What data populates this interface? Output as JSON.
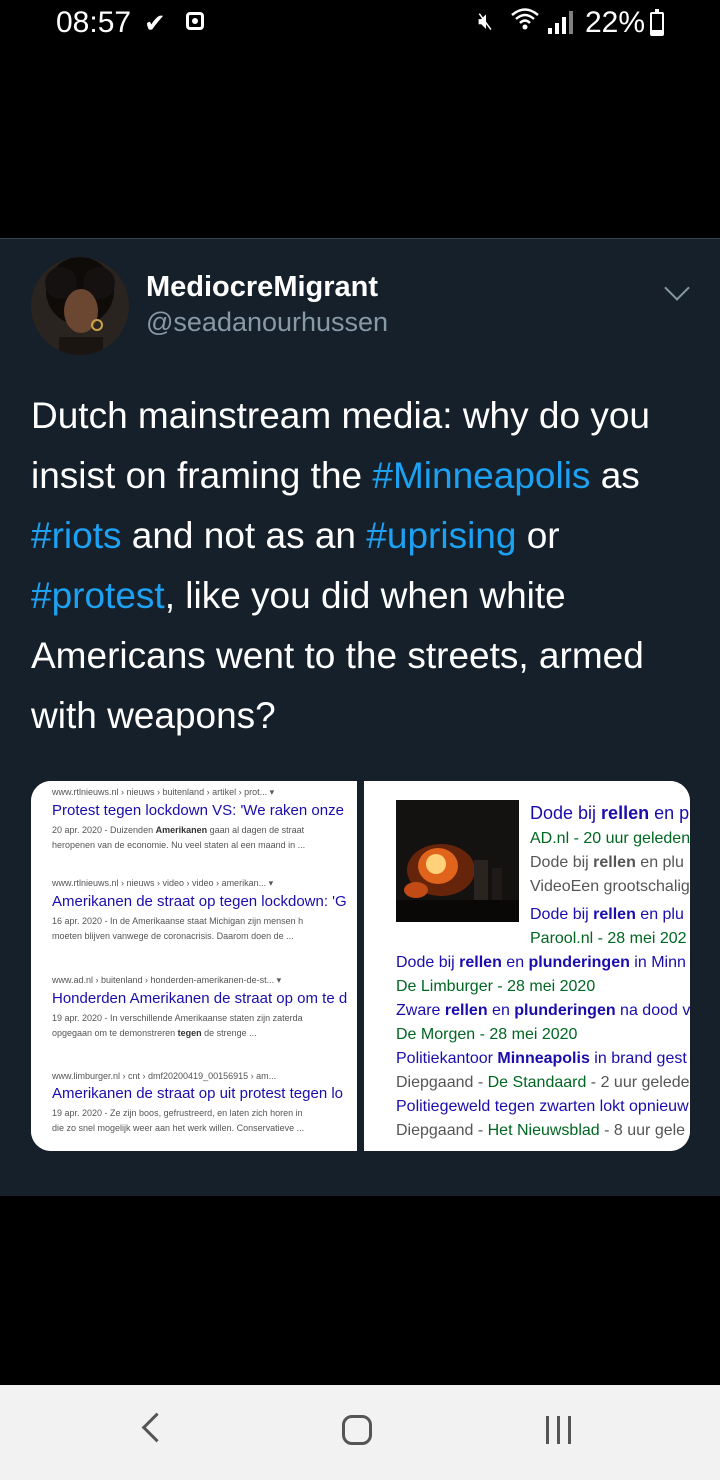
{
  "status_bar": {
    "time": "08:57",
    "battery": "22%"
  },
  "tweet": {
    "display_name": "MediocreMigrant",
    "handle": "@seadanourhussen",
    "text_parts": [
      "Dutch mainstream media: why do you insist on framing the ",
      "#Minneapolis",
      " as ",
      "#riots",
      " and not as an ",
      "#uprising",
      " or ",
      "#protest",
      ", like you did when white Americans went to the streets, armed with weapons?"
    ]
  },
  "left_results": [
    {
      "url": "www.rtlnieuws.nl › nieuws › buitenland › artikel › prot... ▾",
      "title": "Protest tegen lockdown VS: 'We raken onze",
      "snippet1_pre": "20 apr. 2020 - Duizenden ",
      "snippet1_bold": "Amerikanen",
      "snippet1_post": " gaan al dagen de straat",
      "snippet2": "heropenen van de economie. Nu veel staten al een maand in ..."
    },
    {
      "url": "www.rtlnieuws.nl › nieuws › video › video › amerikan... ▾",
      "title": "Amerikanen de straat op tegen lockdown: 'G",
      "snippet1_pre": "16 apr. 2020 - In de Amerikaanse staat Michigan zijn mensen h",
      "snippet1_bold": "",
      "snippet1_post": "",
      "snippet2": "moeten blijven vanwege de coronacrisis. Daarom doen de ..."
    },
    {
      "url": "www.ad.nl › buitenland › honderden-amerikanen-de-st... ▾",
      "title": "Honderden Amerikanen de straat op om te d",
      "snippet1_pre": "19 apr. 2020 - In verschillende Amerikaanse staten zijn zaterda",
      "snippet1_bold": "",
      "snippet1_post": "",
      "snippet2_pre": "opgegaan om te demonstreren ",
      "snippet2_bold": "tegen",
      "snippet2_post": " de strenge ..."
    },
    {
      "url": "www.limburger.nl › cnt › dmf20200419_00156915 › am...",
      "title": "Amerikanen de straat op uit protest tegen lo",
      "snippet1_pre": "19 apr. 2020 - Ze zijn boos, gefrustreerd, en laten zich horen in",
      "snippet1_bold": "",
      "snippet1_post": "",
      "snippet2": "die zo snel mogelijk weer aan het werk willen. Conservatieve ..."
    }
  ],
  "right_results": {
    "r1_title_pre": "Dode bij ",
    "r1_title_bold": "rellen",
    "r1_title_post": " en p",
    "r1_source": "AD.nl - 20 uur geleden",
    "r1_line3_pre": "Dode bij ",
    "r1_line3_bold": "rellen",
    "r1_line3_post": " en plu",
    "r1_line4": "VideoEen grootschalig",
    "r2_title_pre": "Dode bij ",
    "r2_title_bold": "rellen",
    "r2_title_post": " en plu",
    "r2_source": "Parool.nl - 28 mei 202",
    "r3_pre": "Dode bij ",
    "r3_b1": "rellen",
    "r3_mid": " en ",
    "r3_b2": "plunderingen",
    "r3_post": " in Minn",
    "r3_source": "De Limburger - 28 mei 2020",
    "r4_pre": "Zware ",
    "r4_b1": "rellen",
    "r4_mid": " en ",
    "r4_b2": "plunderingen",
    "r4_post": " na dood v",
    "r4_source": "De Morgen - 28 mei 2020",
    "r5_pre": "Politiekantoor ",
    "r5_b1": "Minneapolis",
    "r5_post": " in brand gest",
    "r5_meta_pre": "Diepgaand - ",
    "r5_meta_green": "De Standaard",
    "r5_meta_post": " - 2 uur gelede",
    "r6_title": "Politiegeweld tegen zwarten lokt opnieuw",
    "r6_meta_pre": "Diepgaand - ",
    "r6_meta_green": "Het Nieuwsblad",
    "r6_meta_post": " - 8 uur gele"
  },
  "icons": {
    "status": [
      "check-icon",
      "screen-record-icon",
      "mute-icon",
      "wifi-icon",
      "signal-icon",
      "battery-icon"
    ],
    "nav": [
      "back-icon",
      "home-icon",
      "recent-apps-icon"
    ],
    "tweet": [
      "chevron-down-icon"
    ]
  },
  "colors": {
    "tweet_bg": "#15202b",
    "hashtag": "#1da1f2",
    "handle": "#8899a6",
    "link_title": "#1a0dab",
    "source_green": "#006621"
  }
}
